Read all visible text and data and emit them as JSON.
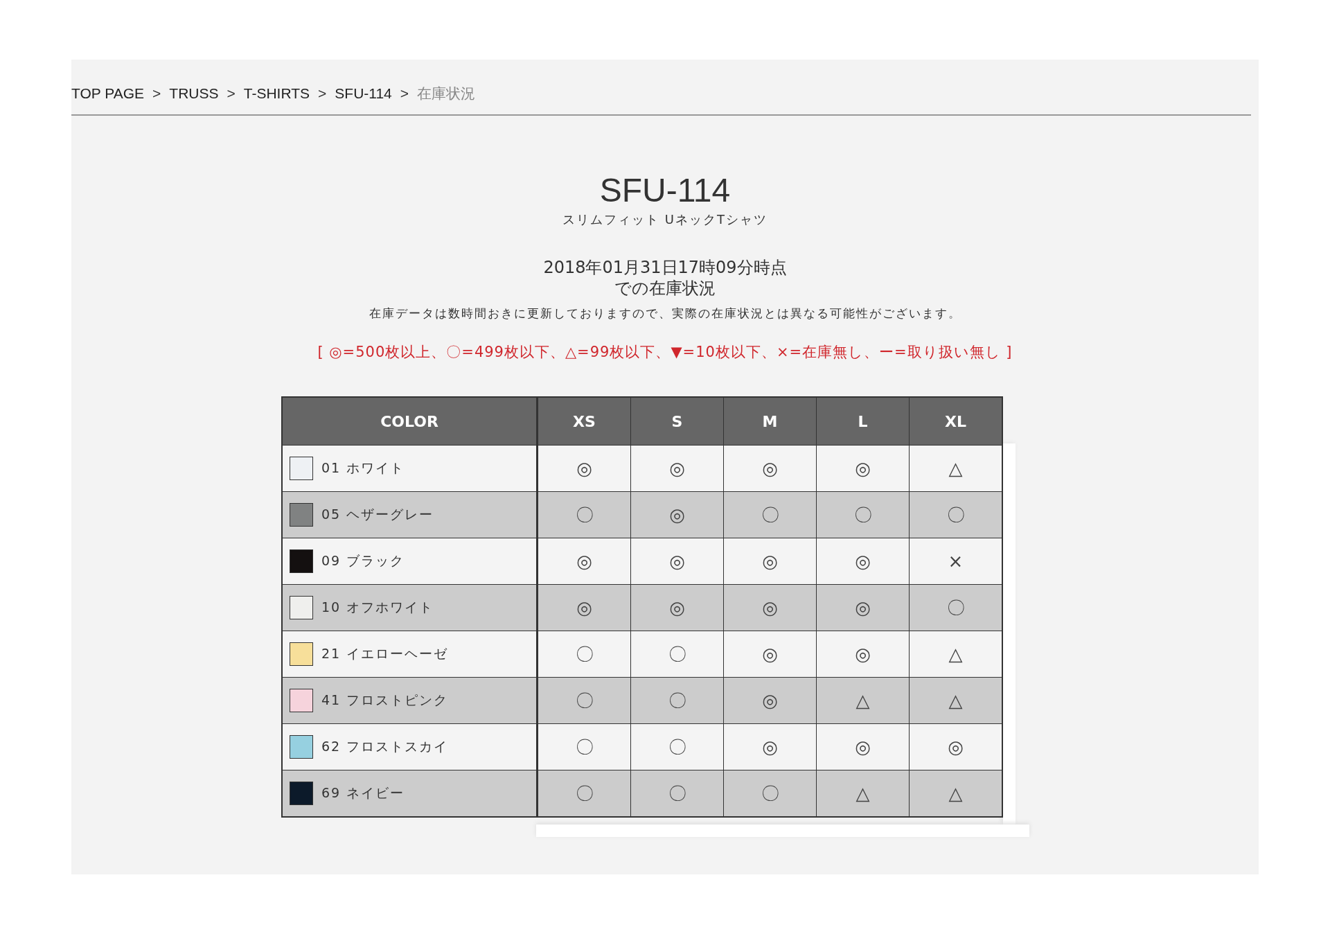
{
  "breadcrumb": [
    {
      "label": "TOP PAGE",
      "current": false
    },
    {
      "label": "TRUSS",
      "current": false
    },
    {
      "label": "T-SHIRTS",
      "current": false
    },
    {
      "label": "SFU-114",
      "current": false
    },
    {
      "label": "在庫状況",
      "current": true
    }
  ],
  "breadcrumb_separator": ">",
  "product": {
    "code": "SFU-114",
    "name": "スリムフィット UネックTシャツ"
  },
  "timestamp": [
    "2018年01月31日17時09分時点",
    "での在庫状況"
  ],
  "note": "在庫データは数時間おきに更新しておりますので、実際の在庫状況とは異なる可能性がございます。",
  "legend": "[ ◎=500枚以上、〇=499枚以下、△=99枚以下、▼=10枚以下、×=在庫無し、ー=取り扱い無し ]",
  "table": {
    "columns": [
      "COLOR",
      "XS",
      "S",
      "M",
      "L",
      "XL"
    ],
    "rows": [
      {
        "color_name": "01 ホワイト",
        "color": "#eef1f4",
        "stock": [
          "◎",
          "◎",
          "◎",
          "◎",
          "△"
        ]
      },
      {
        "color_name": "05 ヘザーグレー",
        "color": "#808282",
        "stock": [
          "〇",
          "◎",
          "〇",
          "〇",
          "〇"
        ]
      },
      {
        "color_name": "09 ブラック",
        "color": "#141010",
        "stock": [
          "◎",
          "◎",
          "◎",
          "◎",
          "×"
        ]
      },
      {
        "color_name": "10 オフホワイト",
        "color": "#efefed",
        "stock": [
          "◎",
          "◎",
          "◎",
          "◎",
          "〇"
        ]
      },
      {
        "color_name": "21 イエローヘーゼ",
        "color": "#f7df9a",
        "stock": [
          "〇",
          "〇",
          "◎",
          "◎",
          "△"
        ]
      },
      {
        "color_name": "41 フロストピンク",
        "color": "#f6d3dc",
        "stock": [
          "〇",
          "〇",
          "◎",
          "△",
          "△"
        ]
      },
      {
        "color_name": "62 フロストスカイ",
        "color": "#96d0e0",
        "stock": [
          "〇",
          "〇",
          "◎",
          "◎",
          "◎"
        ]
      },
      {
        "color_name": "69 ネイビー",
        "color": "#0c1a2a",
        "stock": [
          "〇",
          "〇",
          "〇",
          "△",
          "△"
        ]
      }
    ]
  }
}
